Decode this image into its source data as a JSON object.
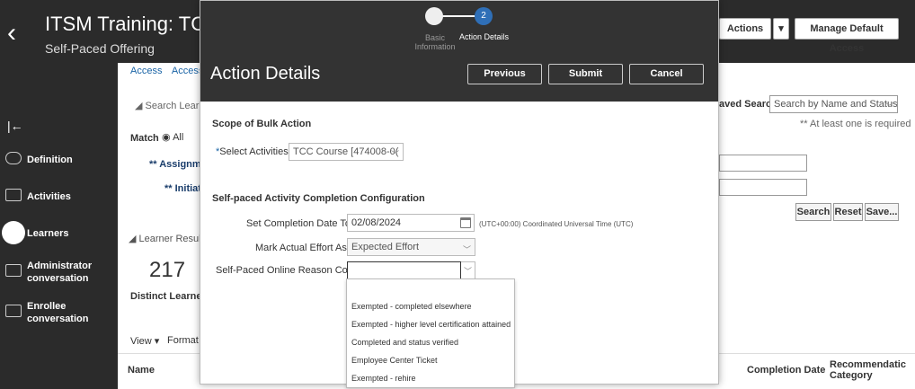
{
  "page": {
    "title": "ITSM Training: TCC",
    "subtitle": "Self-Paced Offering",
    "actions_label": "Actions",
    "actions_menu_icon": "caret-down-icon",
    "manage_access_label": "Manage Default Access"
  },
  "nav": {
    "items": [
      {
        "label": "Definition",
        "icon": "gears-icon"
      },
      {
        "label": "Activities",
        "icon": "list-icon"
      },
      {
        "label": "Learners",
        "icon": "learners-icon"
      },
      {
        "label": "Administrator conversation",
        "icon": "chat-icon"
      },
      {
        "label": "Enrollee conversation",
        "icon": "chat-icon"
      }
    ]
  },
  "background": {
    "crumbs": [
      "Access",
      "Access"
    ],
    "search_learners": "Search Learne",
    "match_label": "Match",
    "match_all": "All",
    "assignment_label": "Assignme",
    "initiation_label": "Initiati",
    "saved_search_label": "aved Search",
    "saved_search_value": "Search by Name and Status",
    "required_note": "** At least one is required",
    "search_btn": "Search",
    "reset_btn": "Reset",
    "save_btn": "Save...",
    "learner_results": "Learner Result",
    "count": "217",
    "distinct_learners": "Distinct Learner",
    "view_label": "View",
    "format_label": "Format",
    "col_name": "Name",
    "col_completion_date": "Completion Date",
    "col_recommendation": "Recommendatic",
    "col_category": "Category"
  },
  "modal": {
    "step1_label": "Basic Information",
    "step2_number": "2",
    "step2_label": "Action Details",
    "title": "Action Details",
    "previous_label": "Previous",
    "submit_label": "Submit",
    "cancel_label": "Cancel",
    "scope_title": "Scope of Bulk Action",
    "select_activities_label": "Select Activities",
    "select_activities_value": "TCC Course [474008-0(",
    "config_title": "Self-paced Activity Completion Configuration",
    "completion_date_label": "Set Completion Date To",
    "completion_date_value": "02/08/2024",
    "timezone_note": "(UTC+00:00) Coordinated Universal Time (UTC)",
    "effort_label": "Mark Actual Effort As",
    "effort_value": "Expected Effort",
    "reason_label": "Self-Paced Online Reason Code",
    "reason_options": [
      "Exempted - completed elsewhere",
      "Exempted - higher level certification attained",
      "Completed and status verified",
      "Employee Center Ticket",
      "Exempted - rehire"
    ]
  }
}
